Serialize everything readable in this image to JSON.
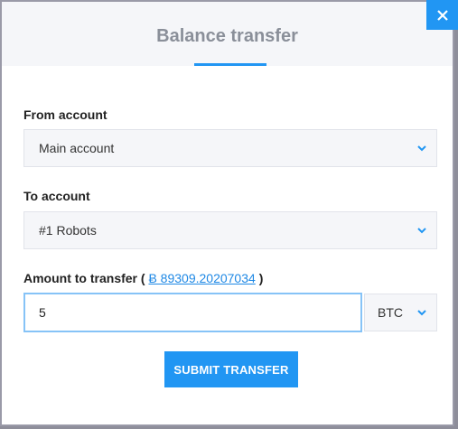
{
  "modal": {
    "title": "Balance transfer",
    "close_label": "×"
  },
  "form": {
    "from_account": {
      "label": "From account",
      "selected": "Main account"
    },
    "to_account": {
      "label": "To account",
      "selected": "#1 Robots"
    },
    "amount": {
      "label": "Amount to transfer",
      "paren_open": "(",
      "balance": "Ƀ 89309.20207034",
      "paren_close": ")",
      "value": "5",
      "currency": "BTC"
    },
    "submit_label": "SUBMIT TRANSFER"
  },
  "icons": {
    "close": "close-icon",
    "chevron": "chevron-down-icon"
  },
  "colors": {
    "accent": "#2196f3",
    "link": "#1e88e5",
    "field_bg": "#f5f6f9",
    "title_text": "#8a8f99"
  }
}
